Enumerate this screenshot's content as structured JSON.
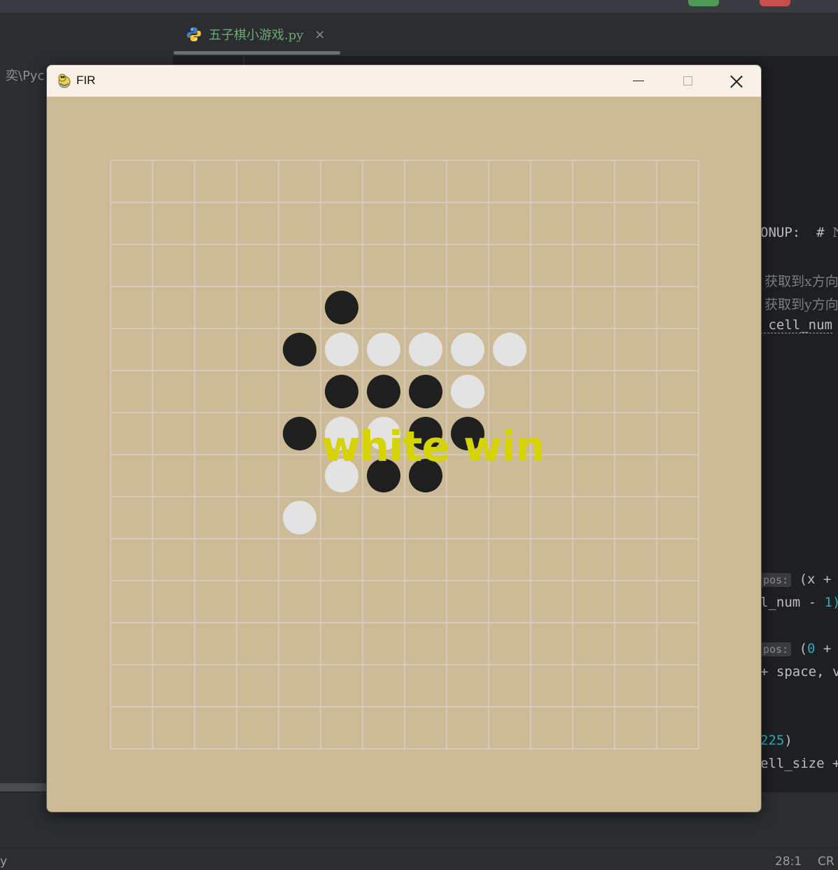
{
  "ide": {
    "path_fragment": "奕\\Pyc",
    "tab": {
      "label": "五子棋小游戏.py",
      "close_glyph": "×"
    },
    "code_lines": [
      {
        "id": "l1",
        "parts": [
          {
            "t": "ONUP:  # ",
            "c": ""
          },
          {
            "t": "N",
            "c": "code-comment"
          }
        ]
      },
      {
        "id": "l2",
        "parts": [
          {
            "t": " 获取到x方向",
            "c": "code-comment"
          }
        ]
      },
      {
        "id": "l3",
        "parts": [
          {
            "t": " 获取到y方向",
            "c": "code-comment"
          }
        ]
      },
      {
        "id": "l4",
        "parts": [
          {
            "t": " cell_num",
            "c": "squiggle"
          }
        ]
      },
      {
        "id": "l5",
        "parts": [
          {
            "t": "pos:",
            "c": "code-hint"
          },
          {
            "t": " (x + s",
            "c": ""
          }
        ]
      },
      {
        "id": "l6",
        "parts": [
          {
            "t": "l_num - ",
            "c": ""
          },
          {
            "t": "1)",
            "c": "code-num"
          }
        ]
      },
      {
        "id": "l7",
        "parts": [
          {
            "t": "pos:",
            "c": "code-hint"
          },
          {
            "t": " (",
            "c": ""
          },
          {
            "t": "0",
            "c": "code-num"
          },
          {
            "t": " + s",
            "c": ""
          }
        ]
      },
      {
        "id": "l8",
        "parts": [
          {
            "t": "+ space, v",
            "c": ""
          }
        ]
      },
      {
        "id": "l9",
        "parts": [
          {
            "t": "225",
            "c": "code-num"
          },
          {
            "t": ")",
            "c": ""
          }
        ]
      },
      {
        "id": "l10",
        "parts": [
          {
            "t": "ell_size +",
            "c": ""
          }
        ]
      }
    ],
    "status": {
      "left": "y",
      "position": "28:1",
      "line_sep": "CR"
    }
  },
  "window": {
    "title": "FIR",
    "controls": {
      "minimize": "minimize",
      "maximize": "maximize",
      "close": "close"
    }
  },
  "game": {
    "board_cells": 14,
    "board_color": "#cdbb97",
    "grid_color": "#d6d0c4",
    "black_color": "#1f1f1f",
    "white_color": "#e3e3e3",
    "message": "white win",
    "message_color": "#d6d400",
    "stones": [
      {
        "col": 5,
        "row": 3,
        "color": "black"
      },
      {
        "col": 4,
        "row": 4,
        "color": "black"
      },
      {
        "col": 5,
        "row": 4,
        "color": "white"
      },
      {
        "col": 6,
        "row": 4,
        "color": "white"
      },
      {
        "col": 7,
        "row": 4,
        "color": "white"
      },
      {
        "col": 8,
        "row": 4,
        "color": "white"
      },
      {
        "col": 9,
        "row": 4,
        "color": "white"
      },
      {
        "col": 5,
        "row": 5,
        "color": "black"
      },
      {
        "col": 6,
        "row": 5,
        "color": "black"
      },
      {
        "col": 7,
        "row": 5,
        "color": "black"
      },
      {
        "col": 8,
        "row": 5,
        "color": "white"
      },
      {
        "col": 4,
        "row": 6,
        "color": "black"
      },
      {
        "col": 5,
        "row": 6,
        "color": "white"
      },
      {
        "col": 6,
        "row": 6,
        "color": "white"
      },
      {
        "col": 7,
        "row": 6,
        "color": "black"
      },
      {
        "col": 8,
        "row": 6,
        "color": "black"
      },
      {
        "col": 5,
        "row": 7,
        "color": "white"
      },
      {
        "col": 6,
        "row": 7,
        "color": "black"
      },
      {
        "col": 7,
        "row": 7,
        "color": "black"
      },
      {
        "col": 4,
        "row": 8,
        "color": "white"
      }
    ]
  }
}
